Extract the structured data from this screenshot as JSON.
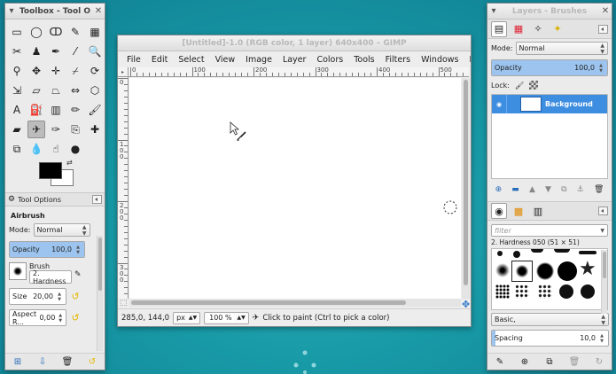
{
  "toolbox": {
    "title": "Toolbox - Tool O",
    "tools": [
      {
        "name": "rect-select-icon",
        "glyph": "▭"
      },
      {
        "name": "ellipse-select-icon",
        "glyph": "◯"
      },
      {
        "name": "free-select-icon",
        "glyph": "ↀ"
      },
      {
        "name": "fuzzy-select-icon",
        "glyph": "✎"
      },
      {
        "name": "by-color-select-icon",
        "glyph": "▦"
      },
      {
        "name": "scissors-icon",
        "glyph": "✂"
      },
      {
        "name": "foreground-select-icon",
        "glyph": "♟"
      },
      {
        "name": "paths-icon",
        "glyph": "✒"
      },
      {
        "name": "color-picker-icon",
        "glyph": "⁄"
      },
      {
        "name": "zoom-icon",
        "glyph": "🔍"
      },
      {
        "name": "measure-icon",
        "glyph": "⚲"
      },
      {
        "name": "move-icon",
        "glyph": "✥"
      },
      {
        "name": "align-icon",
        "glyph": "✛"
      },
      {
        "name": "crop-icon",
        "glyph": "⌿"
      },
      {
        "name": "rotate-icon",
        "glyph": "⟳"
      },
      {
        "name": "scale-icon",
        "glyph": "⇲"
      },
      {
        "name": "shear-icon",
        "glyph": "▱"
      },
      {
        "name": "perspective-icon",
        "glyph": "⏢"
      },
      {
        "name": "flip-icon",
        "glyph": "⇔"
      },
      {
        "name": "cage-icon",
        "glyph": "⬡"
      },
      {
        "name": "text-icon",
        "glyph": "A"
      },
      {
        "name": "bucket-fill-icon",
        "glyph": "⛽"
      },
      {
        "name": "blend-icon",
        "glyph": "▥"
      },
      {
        "name": "pencil-icon",
        "glyph": "✏"
      },
      {
        "name": "paintbrush-icon",
        "glyph": "🖌"
      },
      {
        "name": "eraser-icon",
        "glyph": "▰"
      },
      {
        "name": "airbrush-icon",
        "glyph": "✈"
      },
      {
        "name": "ink-icon",
        "glyph": "✑"
      },
      {
        "name": "clone-icon",
        "glyph": "⎘"
      },
      {
        "name": "heal-icon",
        "glyph": "✚"
      },
      {
        "name": "perspective-clone-icon",
        "glyph": "⧉"
      },
      {
        "name": "blur-icon",
        "glyph": "💧"
      },
      {
        "name": "smudge-icon",
        "glyph": "☝"
      },
      {
        "name": "dodge-burn-icon",
        "glyph": "●"
      }
    ],
    "active_tool": 26,
    "tab_label": "Tool Options",
    "options_heading": "Airbrush",
    "mode_label": "Mode:",
    "mode_value": "Normal",
    "opacity_label": "Opacity",
    "opacity_value": "100,0",
    "opacity_level": 1.0,
    "brush_label": "Brush",
    "brush_value": "2. Hardness",
    "size_label": "Size",
    "size_value": "20,00",
    "aspect_label": "Aspect R...",
    "aspect_value": "0,00"
  },
  "image_window": {
    "title": "[Untitled]-1.0 (RGB color, 1 layer) 640x400 – GIMP",
    "menu": [
      "File",
      "Edit",
      "Select",
      "View",
      "Image",
      "Layer",
      "Colors",
      "Tools",
      "Filters",
      "Windows",
      "Help"
    ],
    "ruler_h": [
      "0",
      "100",
      "200",
      "300",
      "400",
      "500"
    ],
    "ruler_v": [
      "0",
      "100",
      "200",
      "300"
    ],
    "coords": "285,0, 144,0",
    "unit": "px",
    "zoom": "100 %",
    "status_message": "Click to paint (Ctrl to pick a color)"
  },
  "layers_dock": {
    "title": "Layers - Brushes",
    "mode_label": "Mode:",
    "mode_value": "Normal",
    "opacity_label": "Opacity",
    "opacity_value": "100,0",
    "opacity_level": 1.0,
    "lock_label": "Lock:",
    "layer_name": "Background",
    "filter_placeholder": "filter",
    "brush_name": "2. Hardness 050 (51 × 51)",
    "preset_value": "Basic,",
    "spacing_label": "Spacing",
    "spacing_value": "10,0"
  }
}
